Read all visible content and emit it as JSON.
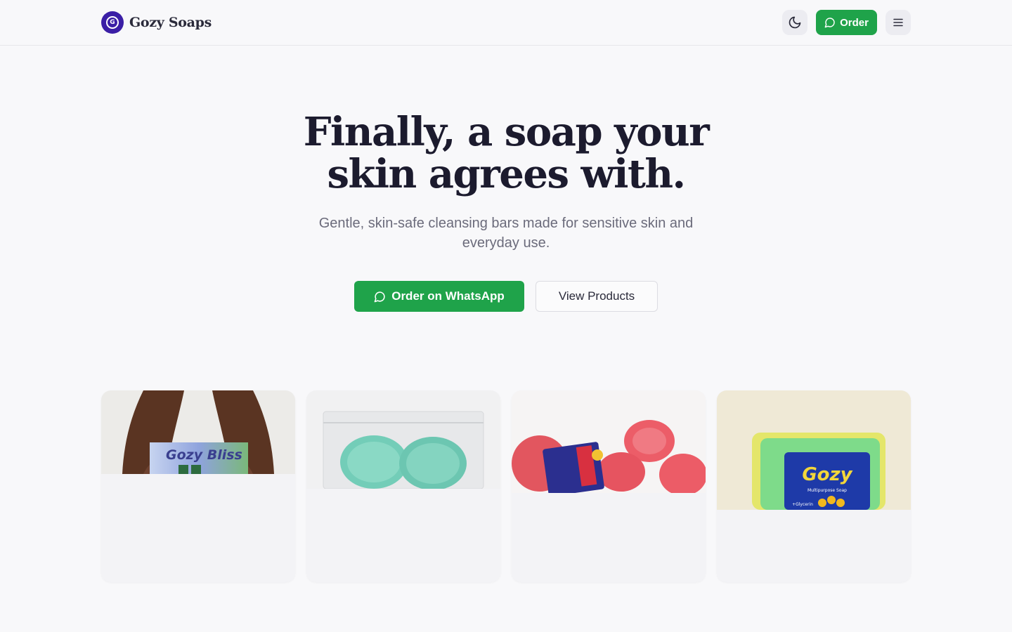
{
  "header": {
    "brand_name": "Gozy Soaps",
    "brand_logo_letter": "G",
    "order_label": "Order",
    "icons": {
      "theme": "moon-icon",
      "order": "chat-bubble-icon",
      "menu": "hamburger-menu-icon"
    }
  },
  "hero": {
    "title_line1": "Finally, a soap your",
    "title_line2": "skin agrees with.",
    "subtitle": "Gentle, skin-safe cleansing bars made for sensitive skin and everyday use.",
    "primary_cta": "Order on WhatsApp",
    "secondary_cta": "View Products"
  },
  "products": [
    {
      "image": "hands-holding-gozy-bliss-box",
      "package_text": "Gozy Bliss"
    },
    {
      "image": "two-mint-green-soap-bars-in-bag"
    },
    {
      "image": "pink-soap-bars-with-wrapper"
    },
    {
      "image": "green-gozy-multipurpose-soap-bar",
      "package_text": "Gozy",
      "package_subtext": "Multipurpose Soap",
      "package_label": "+Glycerin"
    }
  ],
  "colors": {
    "background": "#f8f8fa",
    "brand_purple": "#3b1fa6",
    "whatsapp_green": "#1fa34a",
    "heading": "#1c1b2e",
    "muted_text": "#6b6b7b"
  }
}
